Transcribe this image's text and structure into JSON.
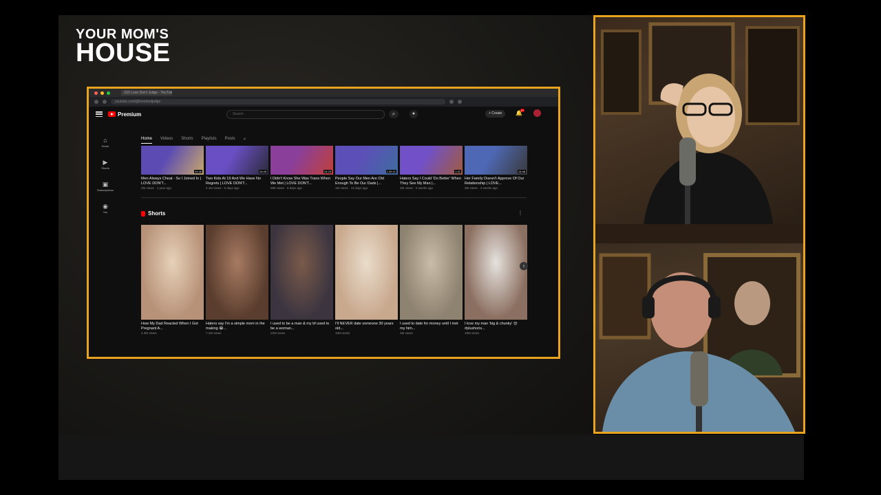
{
  "show_logo": {
    "line1": "YOUR MOM'S",
    "line2": "HOUSE"
  },
  "browser": {
    "tab_title": "(32) Love Don't Judge - YouTube",
    "url": "youtube.com/@lovedontjudge"
  },
  "youtube": {
    "brand": "Premium",
    "search_placeholder": "Search",
    "create_label": "+ Create",
    "notification_badge": "9+",
    "sidebar": [
      {
        "icon": "home-icon",
        "label": "Home"
      },
      {
        "icon": "shorts-icon",
        "label": "Shorts"
      },
      {
        "icon": "subscriptions-icon",
        "label": "Subscriptions"
      },
      {
        "icon": "you-icon",
        "label": "You"
      }
    ],
    "channel_tabs": [
      "Home",
      "Videos",
      "Shorts",
      "Playlists",
      "Posts"
    ],
    "active_tab": "Home",
    "videos": [
      {
        "title": "Men Always Cheat - So I Joined In | LOVE DON'T...",
        "meta": "2M views · 1 year ago",
        "duration": "24:46",
        "colors": [
          "#5b4bb3",
          "#c8a86c"
        ]
      },
      {
        "title": "Two Kids At 19 And We Have No Regrets | LOVE DON'T...",
        "meta": "2.1M views · 5 days ago",
        "duration": "24:45",
        "colors": [
          "#6a4fc4",
          "#2b2b3a"
        ]
      },
      {
        "title": "I Didn't Know She Was Trans When We Met | LOVE DON'T...",
        "meta": "998 views · 8 days ago",
        "duration": "24:23",
        "colors": [
          "#8a3f9a",
          "#c0403a"
        ]
      },
      {
        "title": "People Say Our Men Are Old Enough To Be Our Dads |...",
        "meta": "1M views · 12 days ago",
        "duration": "1:32:21",
        "colors": [
          "#5d4fb8",
          "#3f6da0"
        ]
      },
      {
        "title": "Haters Say I Could 'Do Better' When They See My Man |...",
        "meta": "2M views · 2 weeks ago",
        "duration": "1:31",
        "colors": [
          "#7150c8",
          "#a05c40"
        ]
      },
      {
        "title": "Her Family Doesn't Approve Of Our Relationship | LOVE...",
        "meta": "3M views · 3 weeks ago",
        "duration": "24:48",
        "colors": [
          "#4e68b5",
          "#3a3a3a"
        ]
      }
    ],
    "shorts_heading": "Shorts",
    "shorts": [
      {
        "title": "How My Dad Reacted When I Got Pregnant A...",
        "views": "4.3M views",
        "colors": [
          "#b79279",
          "#e6d1b8"
        ]
      },
      {
        "title": "Haters say I'm a simple mom in the making 😂...",
        "views": "7.1M views",
        "colors": [
          "#5a3d2e",
          "#a77b62"
        ]
      },
      {
        "title": "I used to be a man & my bf used to be a woman...",
        "views": "22M views",
        "colors": [
          "#3c3540",
          "#7a5a4a"
        ]
      },
      {
        "title": "I'll NEVER date someone 30 years old...",
        "views": "10M views",
        "colors": [
          "#c9a98e",
          "#e9dccb"
        ]
      },
      {
        "title": "I used to date for money until I met my him...",
        "views": "2M views",
        "colors": [
          "#8e8270",
          "#c9bca8"
        ]
      },
      {
        "title": "I love my man 'big & chunky' 😍 #plushoris...",
        "views": "19M views",
        "colors": [
          "#8b6f60",
          "#e6e2de"
        ]
      }
    ]
  },
  "accent_color": "#e9a41f"
}
